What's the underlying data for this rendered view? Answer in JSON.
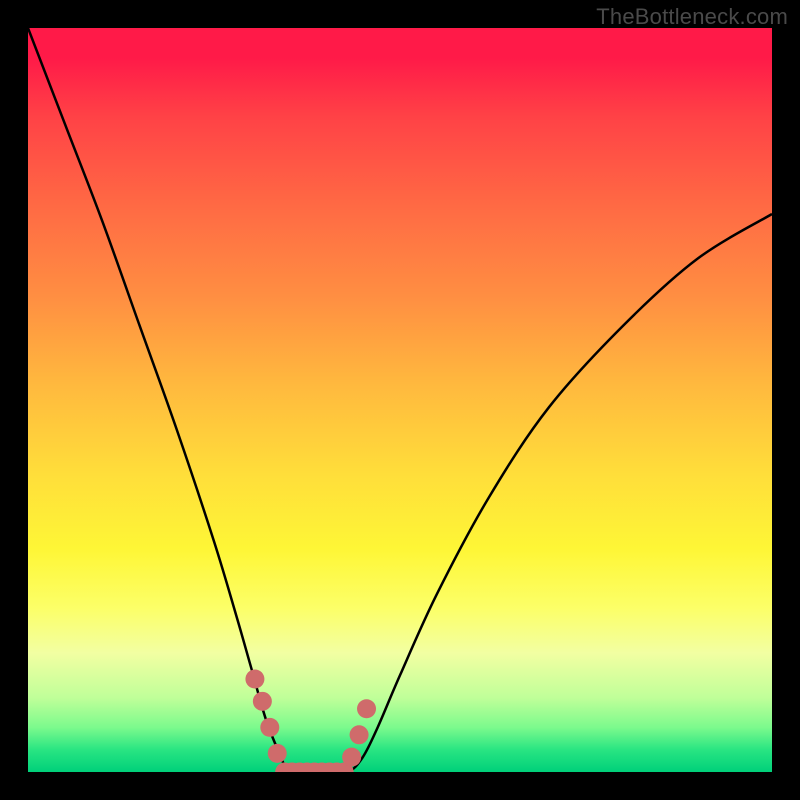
{
  "watermark": "TheBottleneck.com",
  "chart_data": {
    "type": "line",
    "title": "",
    "xlabel": "",
    "ylabel": "",
    "xlim": [
      0,
      1
    ],
    "ylim": [
      0,
      1
    ],
    "grid": false,
    "legend": false,
    "series": [
      {
        "name": "bottleneck-curve",
        "color": "#000000",
        "x": [
          0.0,
          0.05,
          0.1,
          0.15,
          0.2,
          0.25,
          0.28,
          0.3,
          0.32,
          0.34,
          0.35,
          0.37,
          0.4,
          0.43,
          0.45,
          0.47,
          0.5,
          0.55,
          0.62,
          0.7,
          0.8,
          0.9,
          1.0
        ],
        "y": [
          1.0,
          0.87,
          0.74,
          0.6,
          0.46,
          0.31,
          0.21,
          0.14,
          0.07,
          0.02,
          0.0,
          0.0,
          0.0,
          0.0,
          0.02,
          0.06,
          0.13,
          0.24,
          0.37,
          0.49,
          0.6,
          0.69,
          0.75
        ]
      },
      {
        "name": "marker-band",
        "color": "#cf6b6b",
        "type": "scatter",
        "x": [
          0.305,
          0.315,
          0.325,
          0.335,
          0.345,
          0.355,
          0.365,
          0.375,
          0.385,
          0.395,
          0.405,
          0.415,
          0.425,
          0.435,
          0.445,
          0.455
        ],
        "y": [
          0.125,
          0.095,
          0.06,
          0.025,
          0.0,
          0.0,
          0.0,
          0.0,
          0.0,
          0.0,
          0.0,
          0.0,
          0.0,
          0.02,
          0.05,
          0.085
        ]
      }
    ],
    "annotations": []
  }
}
